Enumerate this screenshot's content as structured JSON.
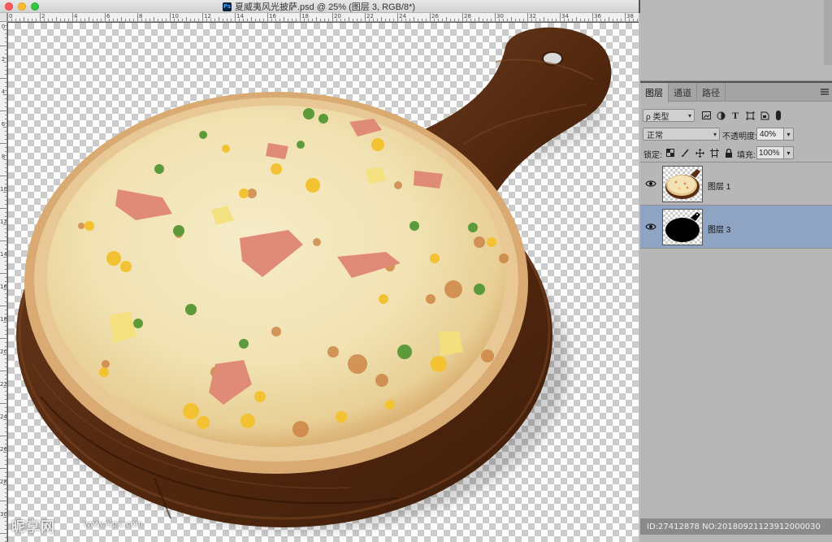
{
  "window": {
    "title": "夏威夷风光披萨.psd @ 25% (图层 3, RGB/8*)",
    "app_badge": "Ps"
  },
  "rulers": {
    "top": [
      "0",
      "2",
      "4",
      "6",
      "8",
      "10",
      "12",
      "14",
      "16",
      "18",
      "20",
      "22",
      "24",
      "26",
      "28",
      "30",
      "32",
      "34",
      "36",
      "38"
    ],
    "left": [
      "0",
      "2",
      "4",
      "6",
      "8",
      "10",
      "12",
      "14",
      "16",
      "18",
      "20",
      "22",
      "24",
      "26",
      "28",
      "30",
      "32"
    ]
  },
  "layers_panel": {
    "tabs": [
      {
        "label": "图层",
        "active": true
      },
      {
        "label": "通道",
        "active": false
      },
      {
        "label": "路径",
        "active": false
      }
    ],
    "filter": {
      "label": "ρ 类型"
    },
    "filter_icons": [
      "image-icon",
      "adjustment-icon",
      "type-icon",
      "shape-icon",
      "smart-object-icon"
    ],
    "blend_mode": "正常",
    "opacity_label": "不透明度:",
    "opacity_value": "40%",
    "lock_label": "锁定:",
    "lock_icons": [
      "lock-transparent-icon",
      "lock-paint-icon",
      "lock-move-icon",
      "lock-artboard-icon",
      "lock-all-icon"
    ],
    "fill_label": "填充:",
    "fill_value": "100%",
    "layers": [
      {
        "name": "图层 1",
        "visible": true,
        "selected": false,
        "thumb": "pizza"
      },
      {
        "name": "图层 3",
        "visible": true,
        "selected": true,
        "thumb": "silhouette"
      }
    ],
    "selection_color": "#8fa3c2"
  },
  "status": {
    "id_text": "ID:27412878 NO:20180921123912000030"
  },
  "watermark": {
    "brand": "昵享网",
    "url": "www.nipic.com"
  }
}
